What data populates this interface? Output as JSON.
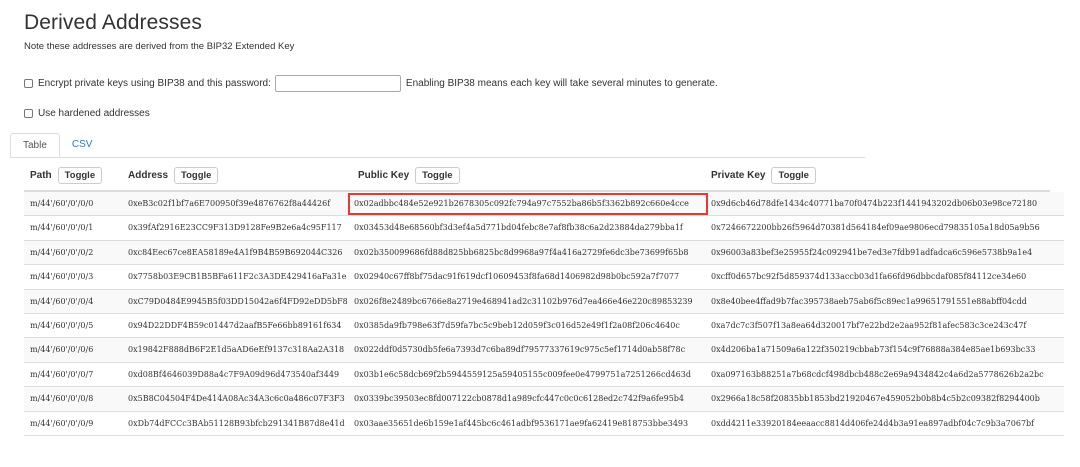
{
  "page": {
    "title": "Derived Addresses",
    "note": "Note these addresses are derived from the BIP32 Extended Key"
  },
  "options": {
    "bip38_label": "Encrypt private keys using BIP38 and this password:",
    "bip38_password": "",
    "bip38_hint": "Enabling BIP38 means each key will take several minutes to generate.",
    "hardened_label": "Use hardened addresses"
  },
  "tabs": [
    {
      "label": "Table"
    },
    {
      "label": "CSV"
    }
  ],
  "columns": {
    "path": "Path",
    "address": "Address",
    "public_key": "Public Key",
    "private_key": "Private Key",
    "toggle": "Toggle"
  },
  "rows": [
    {
      "path": "m/44'/60'/0'/0/0",
      "address": "0xeB3c02f1bf7a6E700950f39e4876762f8a44426f",
      "pub": "0x02adbbc484e52e921b2678305c092fc794a97c7552ba86b5f3362b892c660e4cce",
      "priv": "0x9d6cb46d78dfe1434c40771ba70f0474b223f1441943202db06b03e98ce72180"
    },
    {
      "path": "m/44'/60'/0'/0/1",
      "address": "0x39fAf2916E23CC9F313D9128Fe9B2e6a4c95F117",
      "pub": "0x03453d48e68560bf3d3ef4a5d771bd04febc8e7af8fb38c6a2d23884da279bba1f",
      "priv": "0x7246672200bb26f5964d70381d564184ef09ae9806ecd79835105a18d05a9b56"
    },
    {
      "path": "m/44'/60'/0'/0/2",
      "address": "0xc84Eec67ce8EA58189e4A1f9B4B59B692044C326",
      "pub": "0x02b350099686fd88d825bb6825bc8d9968a97f4a416a2729fe6dc3be73699f65b8",
      "priv": "0x96003a83bef3e25955f24c092941be7ed3e7fdb91adfadca6c596e5738b9a1e4"
    },
    {
      "path": "m/44'/60'/0'/0/3",
      "address": "0x7758b03E9CB1B5BFa611F2c3A3DE429416aFa31e",
      "pub": "0x02940c67ff8bf75dac91f619dcf10609453f8fa68d1406982d98b0bc592a7f7077",
      "priv": "0xcff0d657bc92f5d859374d133accb03d1fa66fd96dbbcdaf085f84112ce34e60"
    },
    {
      "path": "m/44'/60'/0'/0/4",
      "address": "0xC79D0484E9945B5f03DD15042a6f4FD92eDD5bF8",
      "pub": "0x026f8e2489bc6766e8a2719e468941ad2c31102b976d7ea466e46e220c89853239",
      "priv": "0x8e40bee4ffad9b7fac395738aeb75ab6f5c89ec1a99651791551e88abff04cdd"
    },
    {
      "path": "m/44'/60'/0'/0/5",
      "address": "0x94D22DDF4B59c01447d2aafB5Fe66bb89161f634",
      "pub": "0x0385da9fb798e63f7d59fa7bc5c9beb12d059f3c016d52e49f1f2a08f206c4640c",
      "priv": "0xa7dc7c3f507f13a8ea64d320017bf7e22bd2e2aa952f81afec583c3ce243c47f"
    },
    {
      "path": "m/44'/60'/0'/0/6",
      "address": "0x19842F888dB6F2E1d5aAD6eEf9137c318Aa2A318",
      "pub": "0x022ddf0d5730db5fe6a7393d7c6ba89df79577337619c975c5ef1714d0ab58f78c",
      "priv": "0x4d206ba1a71509a6a122f350219cbbab73f154c9f76888a384e85ae1b693bc33"
    },
    {
      "path": "m/44'/60'/0'/0/7",
      "address": "0xd08Bf4646039D88a4c7F9A09d96d473540af3449",
      "pub": "0x03b1e6c58dcb69f2b5944559125a59405155c009fee0e4799751a7251266cd463d",
      "priv": "0xa097163b88251a7b68cdcf498dbcb488c2e69a9434842c4a6d2a5778626b2a2bc"
    },
    {
      "path": "m/44'/60'/0'/0/8",
      "address": "0x5B8C04504F4De414A08Ac34A3c6c0a486c07F3F3",
      "pub": "0x0339bc39503ec8fd007122cb0878d1a989cfc447c0c0c6128ed2c742f9a6fe95b4",
      "priv": "0x2966a18c58f20835bb1853bd21920467e459052b0b8b4c5b2c09382f8294400b"
    },
    {
      "path": "m/44'/60'/0'/0/9",
      "address": "0xDb74dFCCc3BAb51128B93bfcb291341B87d8e41d",
      "pub": "0x03aae35651de6b159e1af445bc6c461adbf9536171ae9fa62419e818753bbe3493",
      "priv": "0xdd4211e33920184eeaacc8814d406fe24d4b3a91ea897adbf04c7c9b3a7067bf"
    }
  ]
}
